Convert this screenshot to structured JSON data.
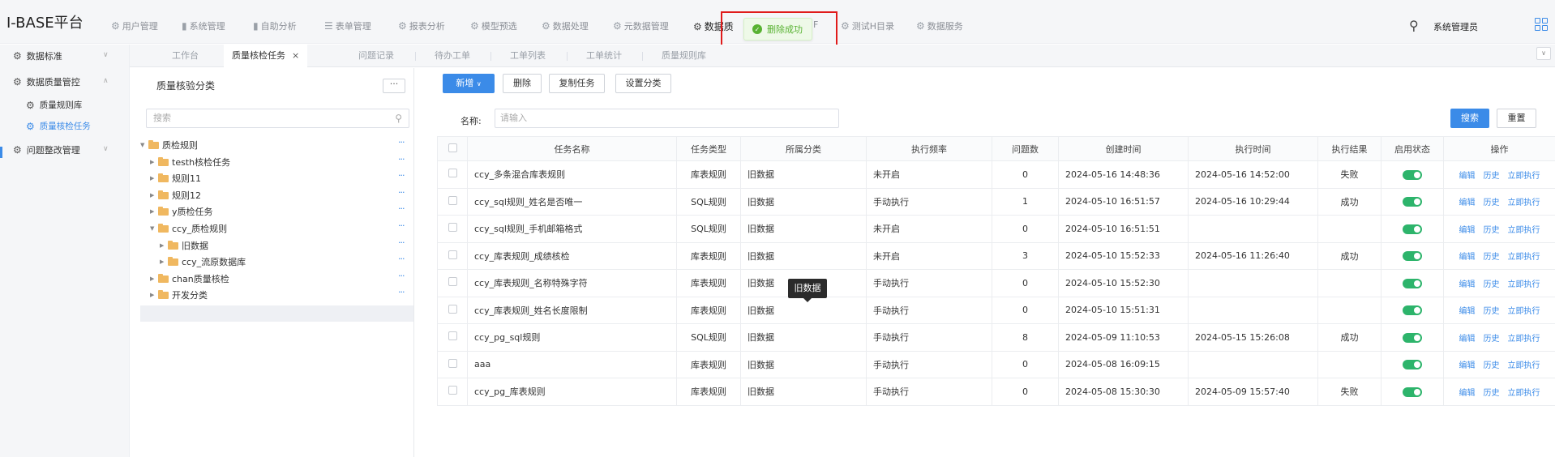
{
  "app": {
    "title": "I-BASE平台"
  },
  "topnav": {
    "items": [
      {
        "label": "用户管理",
        "icon": "gear-icon"
      },
      {
        "label": "系统管理",
        "icon": "bar-chart-icon"
      },
      {
        "label": "自助分析",
        "icon": "bar-chart-icon"
      },
      {
        "label": "表单管理",
        "icon": "list-icon"
      },
      {
        "label": "报表分析",
        "icon": "gear-icon"
      },
      {
        "label": "模型预选",
        "icon": "gear-icon"
      },
      {
        "label": "数据处理",
        "icon": "gear-icon"
      },
      {
        "label": "元数据管理",
        "icon": "gear-icon"
      },
      {
        "label": "数据质量",
        "icon": "gear-icon",
        "active": true
      },
      {
        "label": "测试H目录",
        "icon": "gear-icon"
      },
      {
        "label": "数据服务",
        "icon": "gear-icon"
      }
    ],
    "active_visible_label": "数据质",
    "hidden_suffix": "F",
    "username": "系统管理员"
  },
  "toast": {
    "message": "删除成功",
    "type": "success"
  },
  "tabs": {
    "items": [
      "工作台",
      "质量核检任务",
      "问题记录",
      "待办工单",
      "工单列表",
      "工单统计",
      "质量规则库"
    ],
    "active": "质量核检任务",
    "close_glyph": "×"
  },
  "sidebar": {
    "groups": [
      {
        "label": "数据标准",
        "expanded": false
      },
      {
        "label": "数据质量管控",
        "expanded": true,
        "children": [
          {
            "label": "质量规则库"
          },
          {
            "label": "质量核检任务",
            "selected": true
          }
        ]
      },
      {
        "label": "问题整改管理",
        "expanded": false
      }
    ]
  },
  "tree": {
    "title": "质量核验分类",
    "more_label": "···",
    "search_placeholder": "搜索",
    "nodes": [
      {
        "label": "质检规则",
        "level": 0,
        "expanded": true
      },
      {
        "label": "testh核检任务",
        "level": 1
      },
      {
        "label": "规则11",
        "level": 1
      },
      {
        "label": "规则12",
        "level": 1
      },
      {
        "label": "y质检任务",
        "level": 1
      },
      {
        "label": "ccy_质检规则",
        "level": 1,
        "expanded": true
      },
      {
        "label": "旧数据",
        "level": 2,
        "selected": true
      },
      {
        "label": "ccy_流原数据库",
        "level": 2
      },
      {
        "label": "chan质量核检",
        "level": 1
      },
      {
        "label": "开发分类",
        "level": 1
      }
    ]
  },
  "toolbar": {
    "new_label": "新增",
    "delete_label": "删除",
    "copy_label": "复制任务",
    "set_category_label": "设置分类",
    "search_label": "搜索",
    "reset_label": "重置"
  },
  "filter": {
    "name_label": "名称:",
    "name_placeholder": "请输入"
  },
  "table": {
    "columns": [
      "任务名称",
      "任务类型",
      "所属分类",
      "执行频率",
      "问题数",
      "创建时间",
      "执行时间",
      "执行结果",
      "启用状态",
      "操作"
    ],
    "actions": [
      "编辑",
      "历史",
      "立即执行"
    ],
    "rows": [
      {
        "name": "ccy_多条混合库表规则",
        "type": "库表规则",
        "category": "旧数据",
        "frequency": "未开启",
        "issues": "0",
        "created": "2024-05-16 14:48:36",
        "executed": "2024-05-16 14:52:00",
        "result": "失败",
        "enabled": true
      },
      {
        "name": "ccy_sql规则_姓名是否唯一",
        "type": "SQL规则",
        "category": "旧数据",
        "frequency": "手动执行",
        "issues": "1",
        "created": "2024-05-10 16:51:57",
        "executed": "2024-05-16 10:29:44",
        "result": "成功",
        "enabled": true
      },
      {
        "name": "ccy_sql规则_手机邮箱格式",
        "type": "SQL规则",
        "category": "旧数据",
        "frequency": "未开启",
        "issues": "0",
        "created": "2024-05-10 16:51:51",
        "executed": "",
        "result": "",
        "enabled": true
      },
      {
        "name": "ccy_库表规则_成绩核检",
        "type": "库表规则",
        "category": "旧数据",
        "frequency": "未开启",
        "issues": "3",
        "created": "2024-05-10 15:52:33",
        "executed": "2024-05-16 11:26:40",
        "result": "成功",
        "enabled": true
      },
      {
        "name": "ccy_库表规则_名称特殊字符",
        "type": "库表规则",
        "category": "旧数据",
        "frequency": "手动执行",
        "issues": "0",
        "created": "2024-05-10 15:52:30",
        "executed": "",
        "result": "",
        "enabled": true
      },
      {
        "name": "ccy_库表规则_姓名长度限制",
        "type": "库表规则",
        "category": "旧数据",
        "frequency": "手动执行",
        "issues": "0",
        "created": "2024-05-10 15:51:31",
        "executed": "",
        "result": "",
        "enabled": true
      },
      {
        "name": "ccy_pg_sql规则",
        "type": "SQL规则",
        "category": "旧数据",
        "frequency": "手动执行",
        "issues": "8",
        "created": "2024-05-09 11:10:53",
        "executed": "2024-05-15 15:26:08",
        "result": "成功",
        "enabled": true
      },
      {
        "name": "aaa",
        "type": "库表规则",
        "category": "旧数据",
        "frequency": "手动执行",
        "issues": "0",
        "created": "2024-05-08 16:09:15",
        "executed": "",
        "result": "",
        "enabled": true
      },
      {
        "name": "ccy_pg_库表规则",
        "type": "库表规则",
        "category": "旧数据",
        "frequency": "手动执行",
        "issues": "0",
        "created": "2024-05-08 15:30:30",
        "executed": "2024-05-09 15:57:40",
        "result": "失败",
        "enabled": true
      }
    ]
  },
  "tooltip": {
    "text": "旧数据"
  },
  "colors": {
    "accent": "#3b8be8",
    "success": "#58b232",
    "switch_on": "#2db46b",
    "highlight_box": "#e01b1b"
  }
}
